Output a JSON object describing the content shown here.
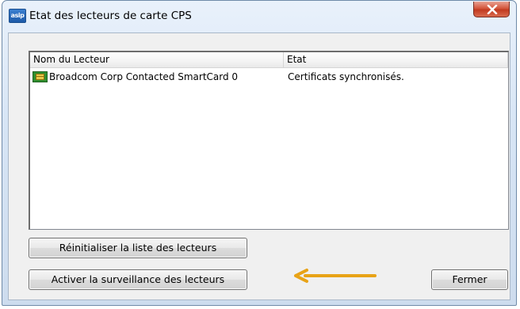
{
  "window": {
    "app_icon_text": "asip",
    "title": "Etat des lecteurs de carte CPS"
  },
  "list": {
    "columns": [
      "Nom du Lecteur",
      "Etat"
    ],
    "rows": [
      {
        "icon": "smartcard-icon",
        "name": "Broadcom Corp Contacted SmartCard 0",
        "state": "Certificats synchronisés."
      }
    ]
  },
  "buttons": {
    "reset_label": "Réinitialiser la liste des lecteurs",
    "monitor_label": "Activer la surveillance des lecteurs",
    "close_label": "Fermer"
  },
  "annotation": {
    "arrow_color": "#e8a317",
    "arrow_direction": "left"
  },
  "colors": {
    "close_button": "#c7432a",
    "window_frame": "#d7e5f5"
  }
}
